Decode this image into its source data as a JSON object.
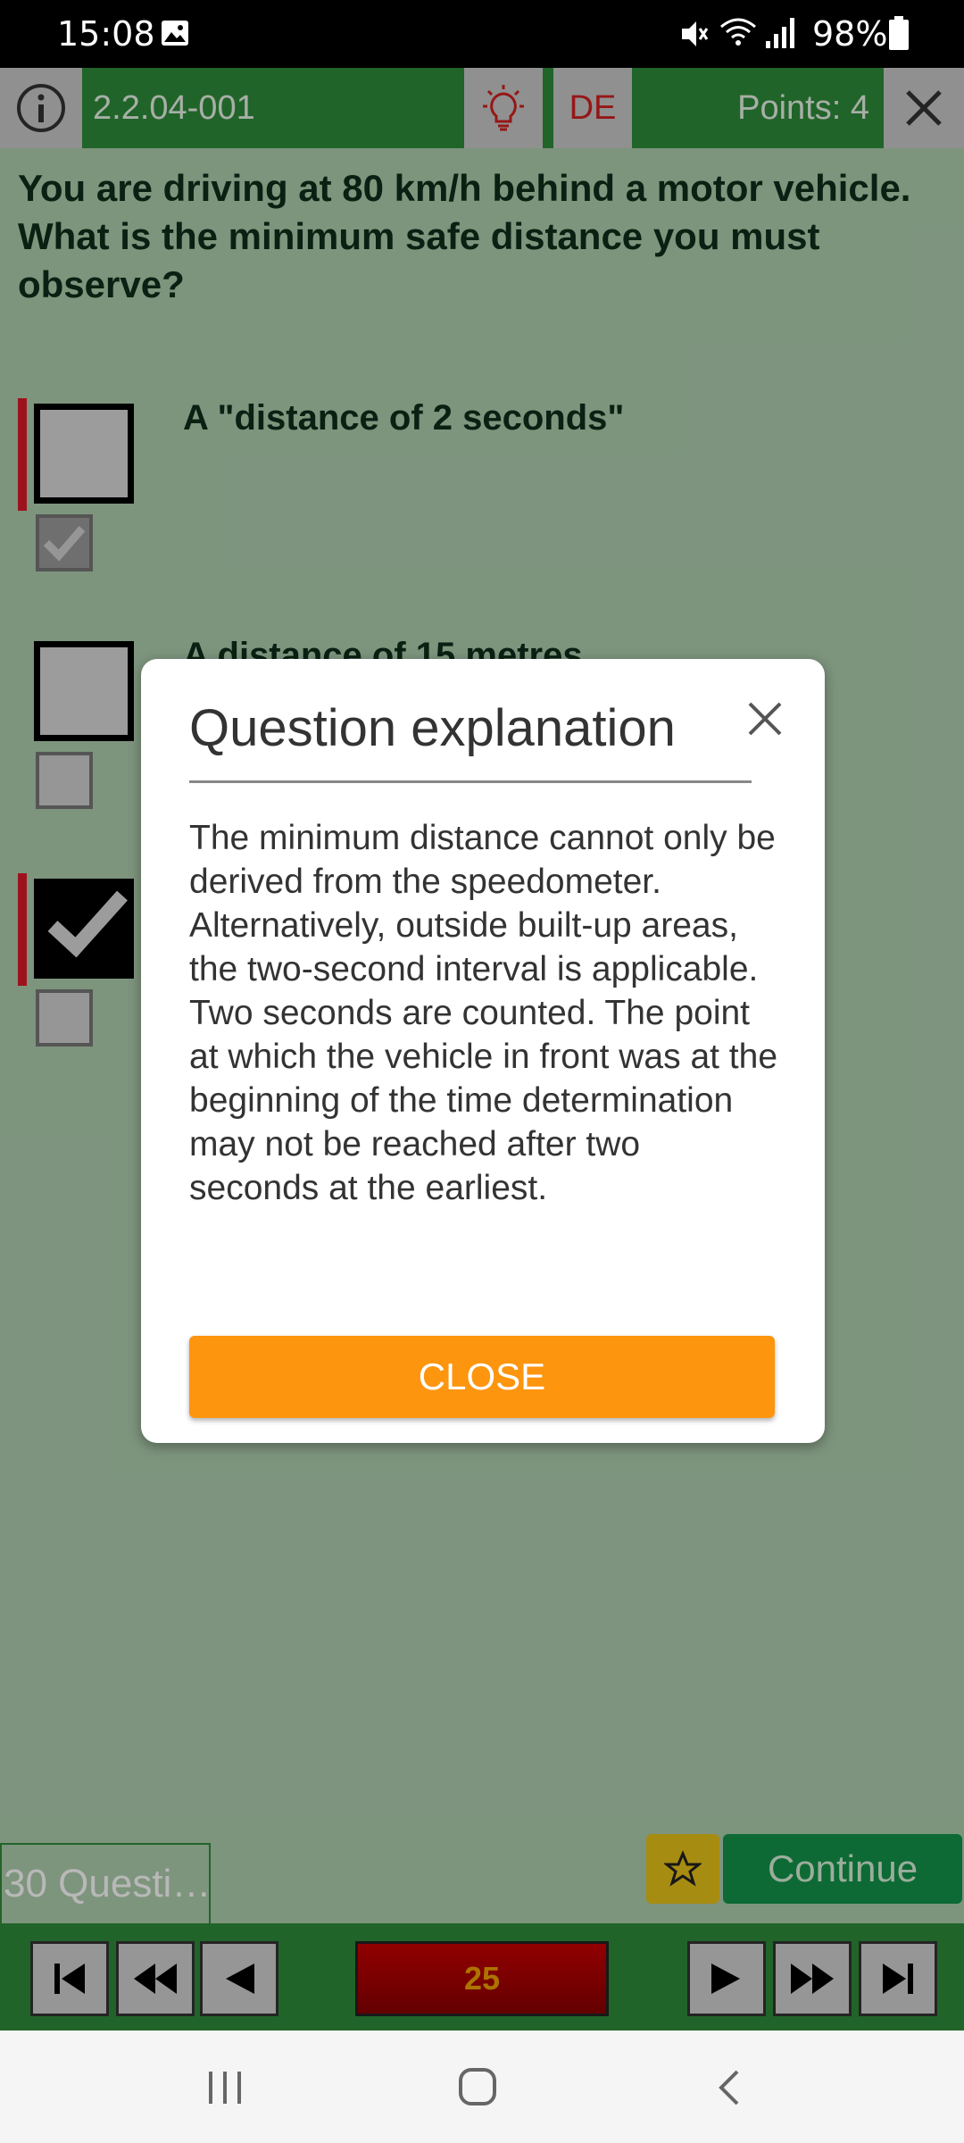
{
  "status_bar": {
    "time": "15:08",
    "battery": "98%"
  },
  "toolbar": {
    "question_id": "2.2.04-001",
    "language": "DE",
    "points": "Points: 4"
  },
  "question": {
    "text": "You are driving at 80 km/h behind a motor vehicle. What is the minimum safe distance you must observe?"
  },
  "answers": [
    {
      "label": "A \"distance of 2 seconds\"",
      "checked": false
    },
    {
      "label": "A distance of 15 metres",
      "checked": false
    },
    {
      "label": "",
      "checked": true
    }
  ],
  "bottom": {
    "question_count": "30 Questi…",
    "continue_label": "Continue",
    "page_number": "25"
  },
  "dialog": {
    "title": "Question explanation",
    "body": "The minimum distance cannot only be derived from the speedometer. Alternatively, out­side built-up areas, the two-sec­ond interval is applicable. Two seconds are counted. The point at which the vehicle in front was at the beginning of the time deter­mination may not be reached af­ter two seconds at the earliest.",
    "close_label": "CLOSE"
  },
  "colors": {
    "toolbar": "#2e8b3a",
    "background": "#aecdae",
    "close_button": "#fd950f",
    "continue": "#13934a",
    "page_indicator": "#c90000"
  },
  "icons": [
    "info-icon",
    "lightbulb-icon",
    "close-icon",
    "star-icon",
    "first-page-icon",
    "rewind-icon",
    "previous-icon",
    "next-icon",
    "fast-forward-icon",
    "last-page-icon"
  ]
}
